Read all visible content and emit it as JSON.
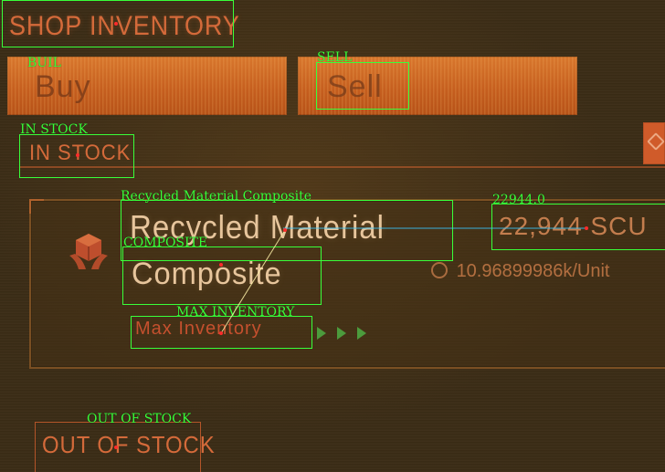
{
  "header": {
    "title": "SHOP INVENTORY"
  },
  "actions": {
    "buy_label": "Buy",
    "sell_label": "Sell"
  },
  "sections": {
    "in_stock_label": "IN STOCK",
    "out_of_stock_label": "OUT OF STOCK"
  },
  "item": {
    "name_line1": "Recycled Material",
    "name_line2": "Composite",
    "quantity_display": "22,944 SCU",
    "price_display": "10.96899986k/Unit",
    "max_inventory_label": "Max Inventory"
  },
  "annotations": {
    "title": "SHOP INVENTORY",
    "buy": "BUIL",
    "sell": "SELL",
    "in_stock": "IN STOCK",
    "recycled": "Recycled Material Composite",
    "quantity_value": "22944.0",
    "composite": "COMPOSITE",
    "max_inventory": "MAX INVENTORY",
    "out_of_stock": "OUT OF STOCK"
  },
  "colors": {
    "accent": "#d46a3a",
    "annotation": "#39ff3a"
  },
  "icons": {
    "item_icon": "hands-holding-crate-icon",
    "price_icon": "coin-icon",
    "max_inventory_arrows": "triple-chevron-icon",
    "right_tab": "diamond-icon"
  }
}
